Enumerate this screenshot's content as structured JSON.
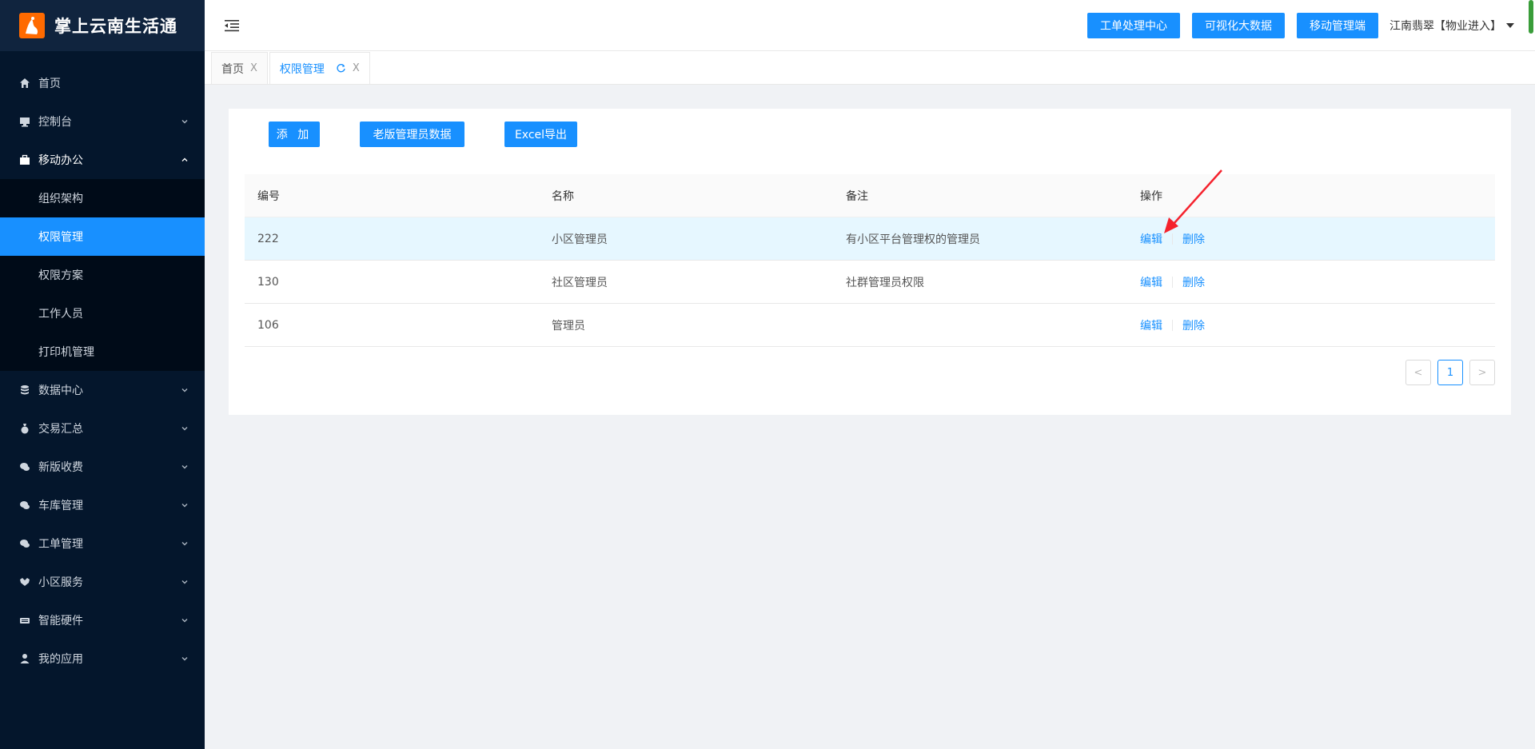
{
  "brand": {
    "title": "掌上云南生活通"
  },
  "sidebar": {
    "items": [
      {
        "label": "首页",
        "icon": "home-icon"
      },
      {
        "label": "控制台",
        "icon": "monitor-icon"
      },
      {
        "label": "移动办公",
        "icon": "briefcase-icon",
        "expanded": true,
        "children": [
          {
            "label": "组织架构"
          },
          {
            "label": "权限管理",
            "selected": true
          },
          {
            "label": "权限方案"
          },
          {
            "label": "工作人员"
          },
          {
            "label": "打印机管理"
          }
        ]
      },
      {
        "label": "数据中心",
        "icon": "database-icon"
      },
      {
        "label": "交易汇总",
        "icon": "money-bag-icon"
      },
      {
        "label": "新版收费",
        "icon": "chat-icon"
      },
      {
        "label": "车库管理",
        "icon": "chat-icon"
      },
      {
        "label": "工单管理",
        "icon": "chat-icon"
      },
      {
        "label": "小区服务",
        "icon": "handshake-icon"
      },
      {
        "label": "智能硬件",
        "icon": "keyboard-icon"
      },
      {
        "label": "我的应用",
        "icon": "user-icon"
      }
    ]
  },
  "header": {
    "buttons": [
      "工单处理中心",
      "可视化大数据",
      "移动管理端"
    ],
    "user": "江南翡翠【物业进入】"
  },
  "tabs": [
    {
      "label": "首页",
      "close": "X"
    },
    {
      "label": "权限管理",
      "close": "X",
      "active": true
    }
  ],
  "toolbar": {
    "add_label": "添 加",
    "old_label": "老版管理员数据",
    "excel_label": "Excel导出"
  },
  "table": {
    "headers": [
      "编号",
      "名称",
      "备注",
      "操作"
    ],
    "rows": [
      {
        "id": "222",
        "name": "小区管理员",
        "note": "有小区平台管理权的管理员",
        "edit": "编辑",
        "delete": "删除"
      },
      {
        "id": "130",
        "name": "社区管理员",
        "note": "社群管理员权限",
        "edit": "编辑",
        "delete": "删除"
      },
      {
        "id": "106",
        "name": "管理员",
        "note": "",
        "edit": "编辑",
        "delete": "删除"
      }
    ]
  },
  "pagination": {
    "prev": "<",
    "current": "1",
    "next": ">"
  },
  "colors": {
    "primary": "#1890ff",
    "sidebar_bg": "#04162c",
    "brand_orange": "#ff6a00",
    "annotation_arrow": "#f5222d"
  }
}
